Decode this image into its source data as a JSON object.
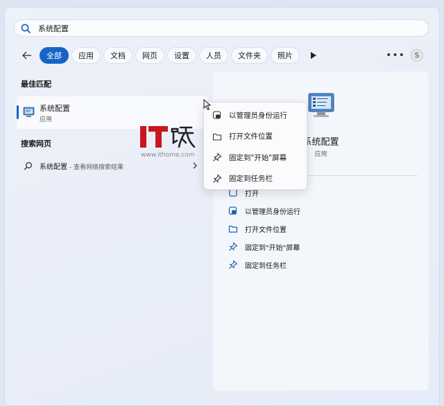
{
  "search": {
    "value": "系统配置"
  },
  "filters": [
    "全部",
    "应用",
    "文档",
    "网页",
    "设置",
    "人员",
    "文件夹",
    "照片"
  ],
  "account": {
    "initial": "S"
  },
  "best_match": {
    "section": "最佳匹配",
    "name": "系统配置",
    "type": "应用"
  },
  "web_search": {
    "section": "搜索网页",
    "query": "系统配置",
    "suffix": " - 查看网络搜索结果"
  },
  "watermark": {
    "site": "www.ithome.com"
  },
  "detail": {
    "title": "系统配置",
    "type": "应用",
    "actions": [
      "打开",
      "以管理员身份运行",
      "打开文件位置",
      "固定到\"开始\"屏幕",
      "固定到任务栏"
    ]
  },
  "context_menu": [
    "以管理员身份运行",
    "打开文件位置",
    "固定到\"开始\"屏幕",
    "固定到任务栏"
  ],
  "colors": {
    "accent": "#1664c8",
    "watermark_red": "#c8161d"
  }
}
